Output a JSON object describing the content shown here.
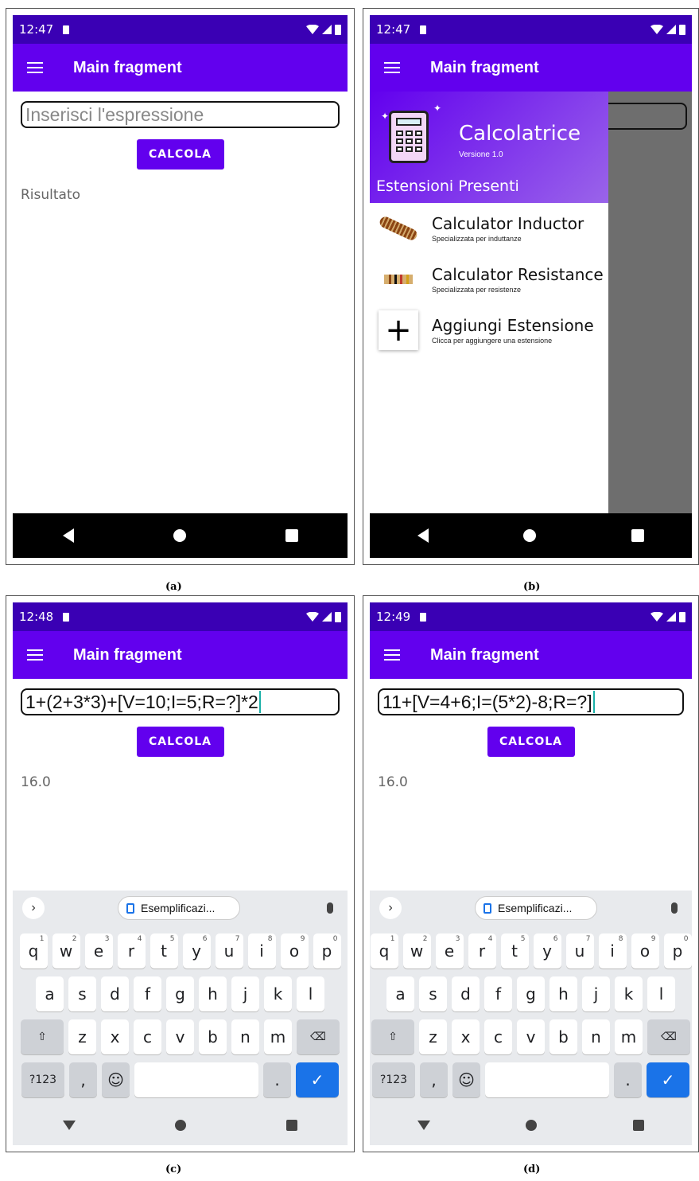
{
  "panels": [
    {
      "caption": "(a)",
      "status_time": "12:47",
      "app_title": "Main fragment",
      "expression_placeholder": "Inserisci l'espressione",
      "button_label": "CALCOLA",
      "result_text": "Risultato"
    },
    {
      "caption": "(b)",
      "status_time": "12:47",
      "app_title": "Main fragment",
      "drawer": {
        "title": "Calcolatrice",
        "version": "Versione 1.0",
        "section": "Estensioni Presenti",
        "items": [
          {
            "name": "Calculator Inductor",
            "sub": "Specializzata per induttanze"
          },
          {
            "name": "Calculator Resistance",
            "sub": "Specializzata per resistenze"
          },
          {
            "name": "Aggiungi Estensione",
            "sub": "Clicca per aggiungere una estensione"
          }
        ]
      }
    },
    {
      "caption": "(c)",
      "status_time": "12:48",
      "app_title": "Main fragment",
      "expression": "1+(2+3*3)+[V=10;I=5;R=?]*2",
      "button_label": "CALCOLA",
      "result_text": "16.0",
      "suggestion_chip": "Esemplificazi..."
    },
    {
      "caption": "(d)",
      "status_time": "12:49",
      "app_title": "Main fragment",
      "expression": "11+[V=4+6;I=(5*2)-8;R=?]",
      "button_label": "CALCOLA",
      "result_text": "16.0",
      "suggestion_chip": "Esemplificazi..."
    }
  ],
  "keyboard": {
    "row1": [
      [
        "q",
        "1"
      ],
      [
        "w",
        "2"
      ],
      [
        "e",
        "3"
      ],
      [
        "r",
        "4"
      ],
      [
        "t",
        "5"
      ],
      [
        "y",
        "6"
      ],
      [
        "u",
        "7"
      ],
      [
        "i",
        "8"
      ],
      [
        "o",
        "9"
      ],
      [
        "p",
        "0"
      ]
    ],
    "row2": [
      "a",
      "s",
      "d",
      "f",
      "g",
      "h",
      "j",
      "k",
      "l"
    ],
    "row3": [
      "z",
      "x",
      "c",
      "v",
      "b",
      "n",
      "m"
    ],
    "symbols_key": "?123",
    "comma_key": ",",
    "period_key": "."
  }
}
